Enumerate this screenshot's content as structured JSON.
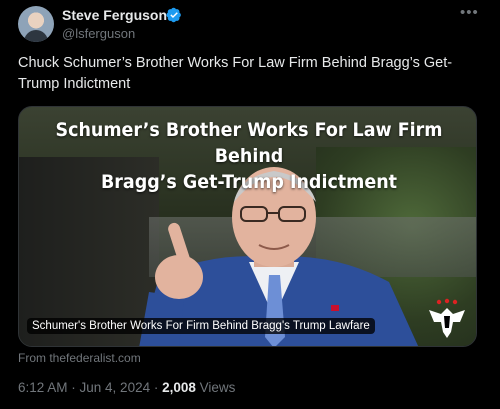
{
  "author": {
    "name": "Steve Ferguson",
    "handle": "@lsferguson",
    "verified": true
  },
  "tweet": {
    "text": "Chuck Schumer’s Brother Works For Law Firm Behind Bragg’s Get-Trump Indictment"
  },
  "card": {
    "headline_line1": "Schumer’s Brother Works For Law Firm Behind",
    "headline_line2": "Bragg’s Get-Trump Indictment",
    "caption": "Schumer's Brother Works For Firm Behind Bragg's Trump Lawfare",
    "source": "From thefederalist.com"
  },
  "meta": {
    "time": "6:12 AM",
    "separator1": " · ",
    "date": "Jun 4, 2024",
    "separator2": " · ",
    "views_count": "2,008",
    "views_label": " Views"
  },
  "icons": {
    "verified": "verified-badge-icon",
    "more": "more-options-icon"
  },
  "colors": {
    "background": "#000000",
    "text_primary": "#e7e9ea",
    "text_secondary": "#71767b",
    "verified_blue": "#1d9bf0"
  }
}
